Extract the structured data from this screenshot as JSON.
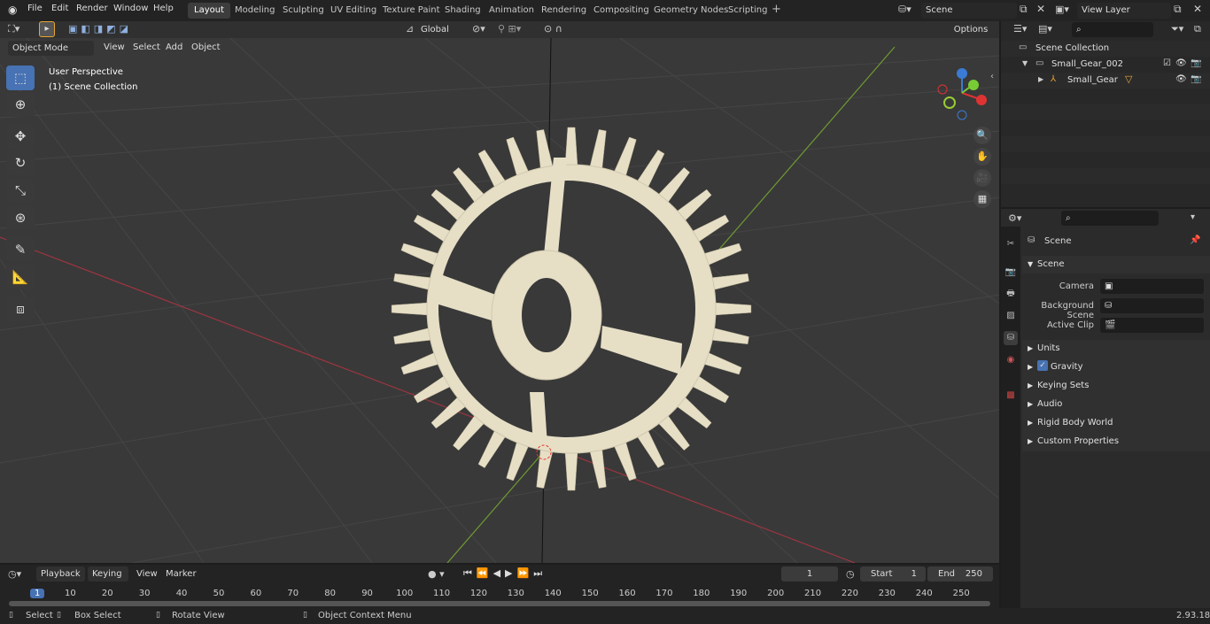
{
  "menu": {
    "file": "File",
    "edit": "Edit",
    "render": "Render",
    "window": "Window",
    "help": "Help"
  },
  "workspaces": [
    "Layout",
    "Modeling",
    "Sculpting",
    "UV Editing",
    "Texture Paint",
    "Shading",
    "Animation",
    "Rendering",
    "Compositing",
    "Geometry Nodes",
    "Scripting"
  ],
  "scene_field": "Scene",
  "view_layer_field": "View Layer",
  "viewport_header": {
    "mode": "Object Mode",
    "view": "View",
    "select": "Select",
    "add": "Add",
    "object": "Object",
    "orientation": "Global",
    "options": "Options"
  },
  "viewport_overlay": {
    "perspective": "User Perspective",
    "collection": "(1) Scene Collection"
  },
  "outliner": {
    "root": "Scene Collection",
    "collection": "Small_Gear_002",
    "object": "Small_Gear"
  },
  "properties": {
    "title": "Scene",
    "section": "Scene",
    "camera_label": "Camera",
    "background_scene_label": "Background Scene",
    "active_clip_label": "Active Clip",
    "panels": [
      "Units",
      "Gravity",
      "Keying Sets",
      "Audio",
      "Rigid Body World",
      "Custom Properties"
    ]
  },
  "timeline": {
    "playback": "Playback",
    "keying": "Keying",
    "view": "View",
    "marker": "Marker",
    "current_frame": "1",
    "start_label": "Start",
    "start": "1",
    "end_label": "End",
    "end": "250",
    "ticks": [
      "1",
      "10",
      "20",
      "30",
      "40",
      "50",
      "60",
      "70",
      "80",
      "90",
      "100",
      "110",
      "120",
      "130",
      "140",
      "150",
      "160",
      "170",
      "180",
      "190",
      "200",
      "210",
      "220",
      "230",
      "240",
      "250"
    ]
  },
  "status": {
    "select": "Select",
    "box_select": "Box Select",
    "rotate_view": "Rotate View",
    "context_menu": "Object Context Menu",
    "version": "2.93.18"
  },
  "colors": {
    "accent": "#4772b3",
    "gear": "#e6dfc6",
    "x_axis": "#b33c47",
    "y_axis": "#6e9a32"
  }
}
